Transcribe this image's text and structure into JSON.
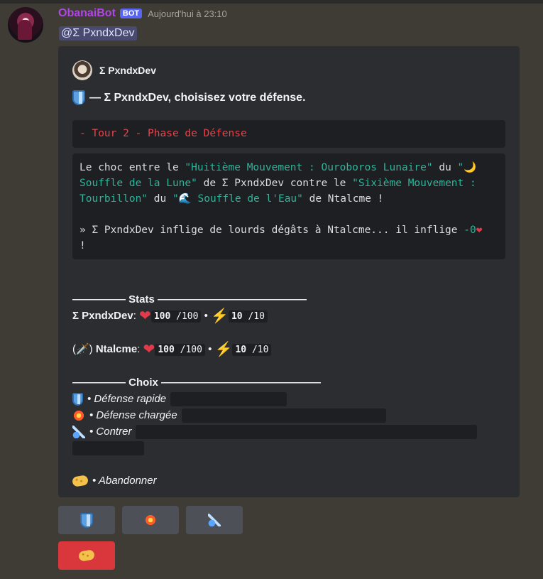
{
  "message": {
    "username": "ObanaiBot",
    "bot_tag": "BOT",
    "timestamp": "Aujourd'hui à 23:10",
    "mention": "@Σ PxndxDev"
  },
  "embed": {
    "author": "Σ PxndxDev",
    "title": "— Σ PxndxDev, choisisez votre défense.",
    "phase": "- Tour 2 - Phase de Défense",
    "combat": {
      "t1": "Le choc entre le ",
      "move1": "\"Huitième Mouvement : Ouroboros Lunaire\"",
      "t2": " du ",
      "breath1_q": "\"",
      "moon_icon": "🌙",
      "breath1": " Souffle de la Lune\"",
      "t3": " de Σ PxndxDev contre le ",
      "move2": "\"Sixième Mouvement : Tourbillon\"",
      "t4": " du ",
      "breath2_q": "\"",
      "wave_icon": "🌊",
      "breath2": " Souffle de l'Eau\"",
      "t5": " de Ntalcme !",
      "result1": "» Σ PxndxDev inflige de lourds dégâts à Ntalcme... il inflige ",
      "damage": "-0",
      "heart": "❤",
      "result_end": "  !"
    },
    "stats": {
      "header": "————— Stats ——————————————",
      "p1_name": "Σ PxndxDev",
      "p1_hp": "100",
      "p1_hp_max": "/100",
      "p1_energy": "10",
      "p1_energy_max": "/10",
      "p2_prefix": "(🗡️)",
      "p2_name": "Ntalcme",
      "p2_hp": "100",
      "p2_hp_max": "/100",
      "p2_energy": "10",
      "p2_energy_max": "/10",
      "sep": "•",
      "colon": ":"
    },
    "choices": {
      "header": "————— Choix ———————————————",
      "items": [
        {
          "icon": "shield-icon",
          "label": "• Défense rapide"
        },
        {
          "icon": "collision-icon",
          "label": "• Défense chargée"
        },
        {
          "icon": "comet-icon",
          "label": "• Contrer"
        }
      ],
      "abandon": "• Abandonner"
    }
  },
  "buttons": [
    {
      "icon": "shield-icon",
      "style": "secondary"
    },
    {
      "icon": "collision-icon",
      "style": "secondary"
    },
    {
      "icon": "comet-icon",
      "style": "secondary"
    },
    {
      "icon": "bandage-icon",
      "style": "danger"
    }
  ],
  "colors": {
    "background": "#3f3c36",
    "embed": "#2b2d31",
    "code": "#1e1f22",
    "username": "#b146e6",
    "phase_red": "#e8424a",
    "quote_cyan": "#2fb39a",
    "danger": "#da373c"
  }
}
